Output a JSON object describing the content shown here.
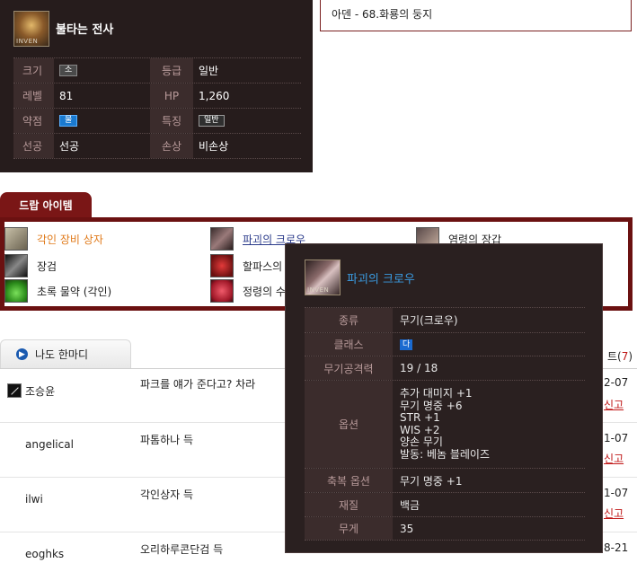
{
  "monster": {
    "name": "불타는 전사",
    "portrait_watermark": "INVEN",
    "stats": [
      [
        {
          "label": "크기",
          "value": "소",
          "style": "badge"
        },
        {
          "label": "등급",
          "value": "일반",
          "style": "text"
        }
      ],
      [
        {
          "label": "레벨",
          "value": "81",
          "style": "text"
        },
        {
          "label": "HP",
          "value": "1,260",
          "style": "text"
        }
      ],
      [
        {
          "label": "약점",
          "value": "물",
          "style": "badge-blue"
        },
        {
          "label": "특징",
          "value": "일반",
          "style": "badge-dark"
        }
      ],
      [
        {
          "label": "선공",
          "value": "선공",
          "style": "text"
        },
        {
          "label": "손상",
          "value": "비손상",
          "style": "text"
        }
      ]
    ]
  },
  "location": "아덴 - 68.화룡의 둥지",
  "drop": {
    "tab_label": "드랍 아이템",
    "items": [
      {
        "name": "각인 장비 상자",
        "icon": "box-icon",
        "style": "orange"
      },
      {
        "name": "파괴의 크로우",
        "icon": "claw-icon",
        "style": "link"
      },
      {
        "name": "염령의 장갑",
        "icon": "glove-icon",
        "style": "normal"
      },
      {
        "name": "장검",
        "icon": "sword-icon",
        "style": "normal"
      },
      {
        "name": "할파스의 ",
        "icon": "red-gem-icon",
        "style": "normal"
      },
      {
        "name": "초록 물약 (각인)",
        "icon": "potion-icon",
        "style": "normal"
      },
      {
        "name": "정령의 수",
        "icon": "rose-icon",
        "style": "normal"
      }
    ]
  },
  "comments": {
    "tab_label": "나도 한마디",
    "reply_count_label": "트(",
    "reply_count": "7",
    "reply_count_close": ")",
    "rows": [
      {
        "user": "조승윤",
        "has_icon": true,
        "text": "파크를 얘가 준다고? 차라",
        "date": "2-07",
        "report": "신고"
      },
      {
        "user": "angelical",
        "has_icon": false,
        "text": "파톰하나 득",
        "date": "1-07",
        "report": "신고"
      },
      {
        "user": "ilwi",
        "has_icon": false,
        "text": "각인상자 득",
        "date": "1-07",
        "report": "신고"
      },
      {
        "user": "eoghks",
        "has_icon": false,
        "text": "오리하루콘단검 득",
        "date": "8-21",
        "report": ""
      }
    ]
  },
  "tooltip": {
    "title": "파괴의 크로우",
    "icon_watermark": "INVEN",
    "rows": [
      {
        "label": "종류",
        "values": [
          "무기(크로우)"
        ]
      },
      {
        "label": "클래스",
        "values": [
          "다"
        ],
        "badge": true
      },
      {
        "label": "무기공격력",
        "values": [
          "19 / 18"
        ]
      },
      {
        "label": "옵션",
        "values": [
          "추가 대미지 +1",
          "무기 명중 +6",
          "STR +1",
          "WIS +2",
          "양손 무기",
          "발동: 베놈 블레이즈"
        ]
      },
      {
        "label": "축복 옵션",
        "values": [
          "무기 명중 +1"
        ]
      },
      {
        "label": "재질",
        "values": [
          "백금"
        ]
      },
      {
        "label": "무게",
        "values": [
          "35"
        ]
      }
    ]
  },
  "colors": {
    "panel_bg": "#261c1c",
    "accent_red": "#6b1111",
    "tooltip_title": "#3a9ae0",
    "report_red": "#c01818"
  }
}
